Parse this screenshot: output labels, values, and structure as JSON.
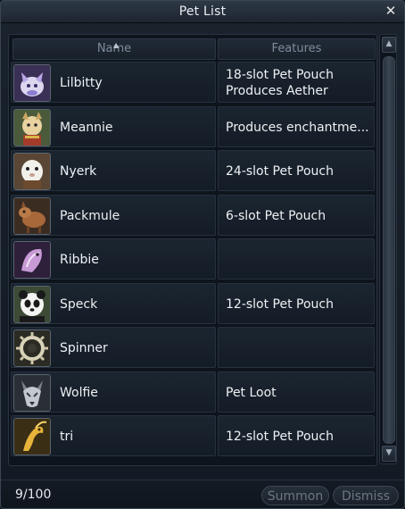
{
  "window": {
    "title": "Pet List"
  },
  "table": {
    "columns": [
      "Name",
      "Features"
    ],
    "rows": [
      {
        "name": "Lilbitty",
        "features": [
          "18-slot Pet Pouch",
          "Produces Aether"
        ],
        "icon": "lilbitty-icon"
      },
      {
        "name": "Meannie",
        "features": [
          "Produces enchantme..."
        ],
        "icon": "meannie-icon"
      },
      {
        "name": "Nyerk",
        "features": [
          "24-slot Pet Pouch"
        ],
        "icon": "nyerk-icon"
      },
      {
        "name": "Packmule",
        "features": [
          "6-slot Pet Pouch"
        ],
        "icon": "packmule-icon"
      },
      {
        "name": "Ribbie",
        "features": [],
        "icon": "ribbie-icon"
      },
      {
        "name": "Speck",
        "features": [
          "12-slot Pet Pouch"
        ],
        "icon": "speck-icon"
      },
      {
        "name": "Spinner",
        "features": [],
        "icon": "spinner-icon"
      },
      {
        "name": "Wolfie",
        "features": [
          "Pet Loot"
        ],
        "icon": "wolfie-icon"
      },
      {
        "name": "tri",
        "features": [
          "12-slot Pet Pouch"
        ],
        "icon": "tri-icon"
      }
    ]
  },
  "footer": {
    "count": "9/100",
    "summon_label": "Summon",
    "dismiss_label": "Dismiss"
  },
  "colors": {
    "text": "#eef1f4",
    "header_text": "#7f8c9b",
    "disabled_text": "#6c7784"
  }
}
